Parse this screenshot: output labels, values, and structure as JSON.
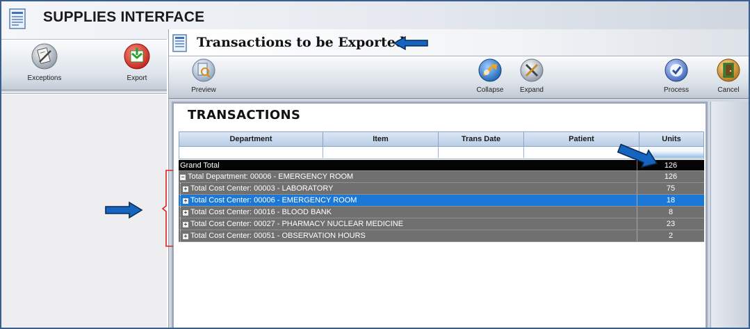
{
  "window": {
    "title": "SUPPLIES INTERFACE"
  },
  "left_toolbar": {
    "exceptions_label": "Exceptions",
    "export_label": "Export"
  },
  "sub_window": {
    "title": "Transactions to be Exported",
    "toolbar": {
      "preview_label": "Preview",
      "collapse_label": "Collapse",
      "expand_label": "Expand",
      "process_label": "Process",
      "cancel_label": "Cancel"
    }
  },
  "section_title": "TRANSACTIONS",
  "grid": {
    "columns": [
      "Department",
      "Item",
      "Trans Date",
      "Patient",
      "Units"
    ],
    "rows": [
      {
        "label": "Grand Total",
        "units": "126"
      },
      {
        "label": "Total Department: 00006 - EMERGENCY ROOM",
        "units": "126"
      },
      {
        "label": "Total Cost Center: 00003 - LABORATORY",
        "units": "75"
      },
      {
        "label": "Total Cost Center: 00006 - EMERGENCY ROOM",
        "units": "18"
      },
      {
        "label": "Total Cost Center: 00016 - BLOOD BANK",
        "units": "8"
      },
      {
        "label": "Total Cost Center: 00027 - PHARMACY NUCLEAR MEDICINE",
        "units": "23"
      },
      {
        "label": "Total Cost Center: 00051 - OBSERVATION HOURS",
        "units": "2"
      }
    ]
  },
  "colors": {
    "selected_row": "#1c78d6",
    "group_row": "#707070",
    "grand_total_row": "#050505",
    "annotation_arrow": "#1565c0",
    "annotation_bracket": "#e02020"
  },
  "icons": {
    "window": "document-icon",
    "exceptions": "clipboard-tools-icon",
    "export": "export-arrows-icon",
    "preview": "preview-magnifier-icon",
    "collapse": "collapse-icon",
    "expand": "expand-tools-icon",
    "process": "checkmark-icon",
    "cancel": "exit-door-icon"
  }
}
